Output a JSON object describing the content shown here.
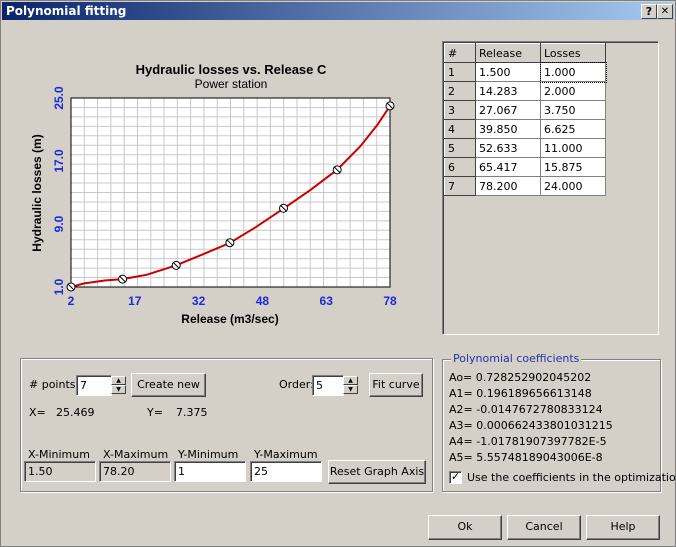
{
  "window": {
    "title": "Polynomial fitting",
    "help_glyph": "?",
    "close_glyph": "✕"
  },
  "chart_data": {
    "type": "line",
    "title": "Hydraulic losses vs. Release C",
    "subtitle": "Power station",
    "xlabel": "Release (m3/sec)",
    "ylabel": "Hydraulic losses (m)",
    "xlim": [
      2,
      78
    ],
    "ylim": [
      1.0,
      25.0
    ],
    "x_ticks": [
      "2",
      "17",
      "32",
      "48",
      "63",
      "78"
    ],
    "y_ticks": [
      "1.0",
      "9.0",
      "17.0",
      "25.0"
    ],
    "grid": true,
    "line_color": "#cc0000",
    "tick_color": "#1a2ad8",
    "points": {
      "x": [
        1.5,
        14.283,
        27.067,
        39.85,
        52.633,
        65.417,
        78.2
      ],
      "y": [
        1.0,
        2.0,
        3.75,
        6.625,
        11.0,
        15.875,
        24.0
      ]
    },
    "fitted_curve": {
      "x": [
        1.5,
        5,
        10,
        14.283,
        20,
        27.067,
        33,
        39.85,
        46,
        52.633,
        59,
        65.417,
        71,
        75,
        78.2
      ],
      "y": [
        1.0,
        1.45,
        1.82,
        2.0,
        2.55,
        3.75,
        5.05,
        6.6,
        8.6,
        10.95,
        13.3,
        15.9,
        18.9,
        21.6,
        24.0
      ]
    }
  },
  "table": {
    "headers": [
      "#",
      "Release",
      "Losses"
    ],
    "rows": [
      [
        "1",
        "1.500",
        "1.000"
      ],
      [
        "2",
        "14.283",
        "2.000"
      ],
      [
        "3",
        "27.067",
        "3.750"
      ],
      [
        "4",
        "39.850",
        "6.625"
      ],
      [
        "5",
        "52.633",
        "11.000"
      ],
      [
        "6",
        "65.417",
        "15.875"
      ],
      [
        "7",
        "78.200",
        "24.000"
      ]
    ]
  },
  "controls": {
    "points_label": "# points:",
    "points_value": "7",
    "create_new": "Create new",
    "order_label": "Order:",
    "order_value": "5",
    "fit_curve": "Fit curve",
    "x_label": "X=",
    "x_value": "25.469",
    "y_label": "Y=",
    "y_value": "7.375",
    "xmin_label": "X-Minimum",
    "xmin_value": "1.50",
    "xmax_label": "X-Maximum",
    "xmax_value": "78.20",
    "ymin_label": "Y-Minimum",
    "ymin_value": "1",
    "ymax_label": "Y-Maximum",
    "ymax_value": "25",
    "reset_axis": "Reset Graph Axis"
  },
  "coefficients": {
    "legend": "Polynomial coefficients",
    "lines": [
      "Ao= 0.728252902045202",
      "A1= 0.196189656613148",
      "A2= -0.0147672780833124",
      "A3= 0.000662433801031215",
      "A4= -1.01781907397782E-5",
      "A5= 5.55748189043006E-8"
    ],
    "use_label": "Use the coefficients in the optimization",
    "use_checked": true
  },
  "footer": {
    "ok": "Ok",
    "cancel": "Cancel",
    "help": "Help"
  }
}
